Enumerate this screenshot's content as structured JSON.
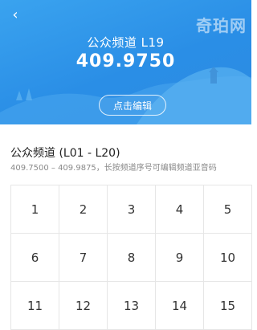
{
  "header": {
    "back_icon": "chevron-left-icon",
    "channel_title": "公众频道 L19",
    "frequency": "409.9750",
    "edit_button": "点击编辑",
    "watermark": "奇珀网"
  },
  "section": {
    "title": "公众频道 (L01 - L20)",
    "description": "409.7500 – 409.9875，长按频道序号可编辑频道亚音码"
  },
  "channels": [
    "1",
    "2",
    "3",
    "4",
    "5",
    "6",
    "7",
    "8",
    "9",
    "10",
    "11",
    "12",
    "13",
    "14",
    "15"
  ],
  "colors": {
    "hero_top": "#3aa3ef",
    "hero_bottom": "#2d8be2",
    "grid_line": "#e6e6e6"
  }
}
